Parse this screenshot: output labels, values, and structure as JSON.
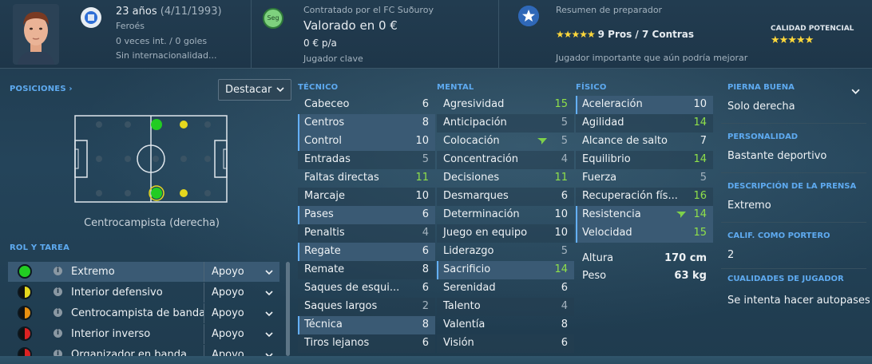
{
  "header": {
    "age": "23 años",
    "dob": "(4/11/1993)",
    "nationality": "Feroés",
    "intl": "0 veces int. / 0 goles",
    "intl_status": "Sin internacionalidad...",
    "contract": "Contratado por el FC Suðuroy",
    "value": "Valorado en 0 €",
    "wage": "0 € p/a",
    "squad_status": "Jugador clave",
    "seg_badge": "Seg",
    "coach_title": "Resumen de preparador",
    "coach_stars": "★★★★★",
    "pros_cons": "9 Pros / 7 Contras",
    "coach_note": "Jugador importante que aún podría mejorar",
    "potential_label": "CALIDAD POTENCIAL",
    "potential_stars": "★★★★★"
  },
  "positions": {
    "title": "POSICIONES ›",
    "highlight_label": "Destacar",
    "caption": "Centrocampista (derecha)"
  },
  "roles": {
    "title": "ROL Y TAREA",
    "info_glyph": "i",
    "items": [
      {
        "name": "Extremo",
        "duty": "Apoyo",
        "color_left": "#22cc22",
        "color_right": "#22cc22"
      },
      {
        "name": "Interior defensivo",
        "duty": "Apoyo",
        "color_left": "#111111",
        "color_right": "#e6d81e"
      },
      {
        "name": "Centrocampista de banda",
        "duty": "Apoyo",
        "color_left": "#111111",
        "color_right": "#e89010"
      },
      {
        "name": "Interior inverso",
        "duty": "Apoyo",
        "color_left": "#111111",
        "color_right": "#dd2222"
      },
      {
        "name": "Organizador en banda",
        "duty": "Apoyo",
        "color_left": "#111111",
        "color_right": "#dd2222"
      }
    ]
  },
  "technical": {
    "title": "TÉCNICO",
    "items": [
      {
        "label": "Cabeceo",
        "value": "6",
        "tone": "norm",
        "key": false
      },
      {
        "label": "Centros",
        "value": "8",
        "tone": "norm",
        "key": true
      },
      {
        "label": "Control",
        "value": "10",
        "tone": "norm",
        "key": true
      },
      {
        "label": "Entradas",
        "value": "5",
        "tone": "lo",
        "key": false
      },
      {
        "label": "Faltas directas",
        "value": "11",
        "tone": "hi",
        "key": false
      },
      {
        "label": "Marcaje",
        "value": "10",
        "tone": "norm",
        "key": false
      },
      {
        "label": "Pases",
        "value": "6",
        "tone": "norm",
        "key": true
      },
      {
        "label": "Penaltis",
        "value": "4",
        "tone": "lo",
        "key": false
      },
      {
        "label": "Regate",
        "value": "6",
        "tone": "norm",
        "key": true
      },
      {
        "label": "Remate",
        "value": "8",
        "tone": "norm",
        "key": false
      },
      {
        "label": "Saques de esqui...",
        "value": "6",
        "tone": "norm",
        "key": false
      },
      {
        "label": "Saques largos",
        "value": "2",
        "tone": "lo",
        "key": false
      },
      {
        "label": "Técnica",
        "value": "8",
        "tone": "norm",
        "key": true
      },
      {
        "label": "Tiros lejanos",
        "value": "6",
        "tone": "norm",
        "key": false
      }
    ]
  },
  "mental": {
    "title": "MENTAL",
    "items": [
      {
        "label": "Agresividad",
        "value": "15",
        "tone": "hi",
        "key": false
      },
      {
        "label": "Anticipación",
        "value": "5",
        "tone": "lo",
        "key": false
      },
      {
        "label": "Colocación",
        "value": "5",
        "tone": "lo",
        "key": false,
        "trend": "up"
      },
      {
        "label": "Concentración",
        "value": "4",
        "tone": "lo",
        "key": false
      },
      {
        "label": "Decisiones",
        "value": "11",
        "tone": "hi",
        "key": false
      },
      {
        "label": "Desmarques",
        "value": "6",
        "tone": "norm",
        "key": false
      },
      {
        "label": "Determinación",
        "value": "10",
        "tone": "norm",
        "key": false
      },
      {
        "label": "Juego en equipo",
        "value": "10",
        "tone": "norm",
        "key": false
      },
      {
        "label": "Liderazgo",
        "value": "5",
        "tone": "lo",
        "key": false
      },
      {
        "label": "Sacrificio",
        "value": "14",
        "tone": "hi",
        "key": true
      },
      {
        "label": "Serenidad",
        "value": "6",
        "tone": "norm",
        "key": false
      },
      {
        "label": "Talento",
        "value": "4",
        "tone": "lo",
        "key": false
      },
      {
        "label": "Valentía",
        "value": "8",
        "tone": "norm",
        "key": false
      },
      {
        "label": "Visión",
        "value": "6",
        "tone": "norm",
        "key": false
      }
    ]
  },
  "physical": {
    "title": "FÍSICO",
    "items": [
      {
        "label": "Aceleración",
        "value": "10",
        "tone": "norm",
        "key": true
      },
      {
        "label": "Agilidad",
        "value": "14",
        "tone": "hi",
        "key": false
      },
      {
        "label": "Alcance de salto",
        "value": "7",
        "tone": "norm",
        "key": false
      },
      {
        "label": "Equilibrio",
        "value": "14",
        "tone": "hi",
        "key": false
      },
      {
        "label": "Fuerza",
        "value": "5",
        "tone": "lo",
        "key": false
      },
      {
        "label": "Recuperación fís...",
        "value": "16",
        "tone": "hi",
        "key": false
      },
      {
        "label": "Resistencia",
        "value": "14",
        "tone": "hi",
        "key": true,
        "trend": "up"
      },
      {
        "label": "Velocidad",
        "value": "15",
        "tone": "hi",
        "key": true
      }
    ],
    "height_label": "Altura",
    "height_value": "170 cm",
    "weight_label": "Peso",
    "weight_value": "63 kg"
  },
  "right": {
    "foot_title": "PIERNA BUENA",
    "foot_value": "Solo derecha",
    "personality_title": "PERSONALIDAD",
    "personality_value": "Bastante deportivo",
    "press_title": "DESCRIPCIÓN DE LA PRENSA",
    "press_value": "Extremo",
    "gk_title": "CALIF. COMO PORTERO",
    "gk_value": "2",
    "traits_title": "CUALIDADES DE JUGADOR",
    "traits_value": "Se intenta hacer autopases"
  }
}
